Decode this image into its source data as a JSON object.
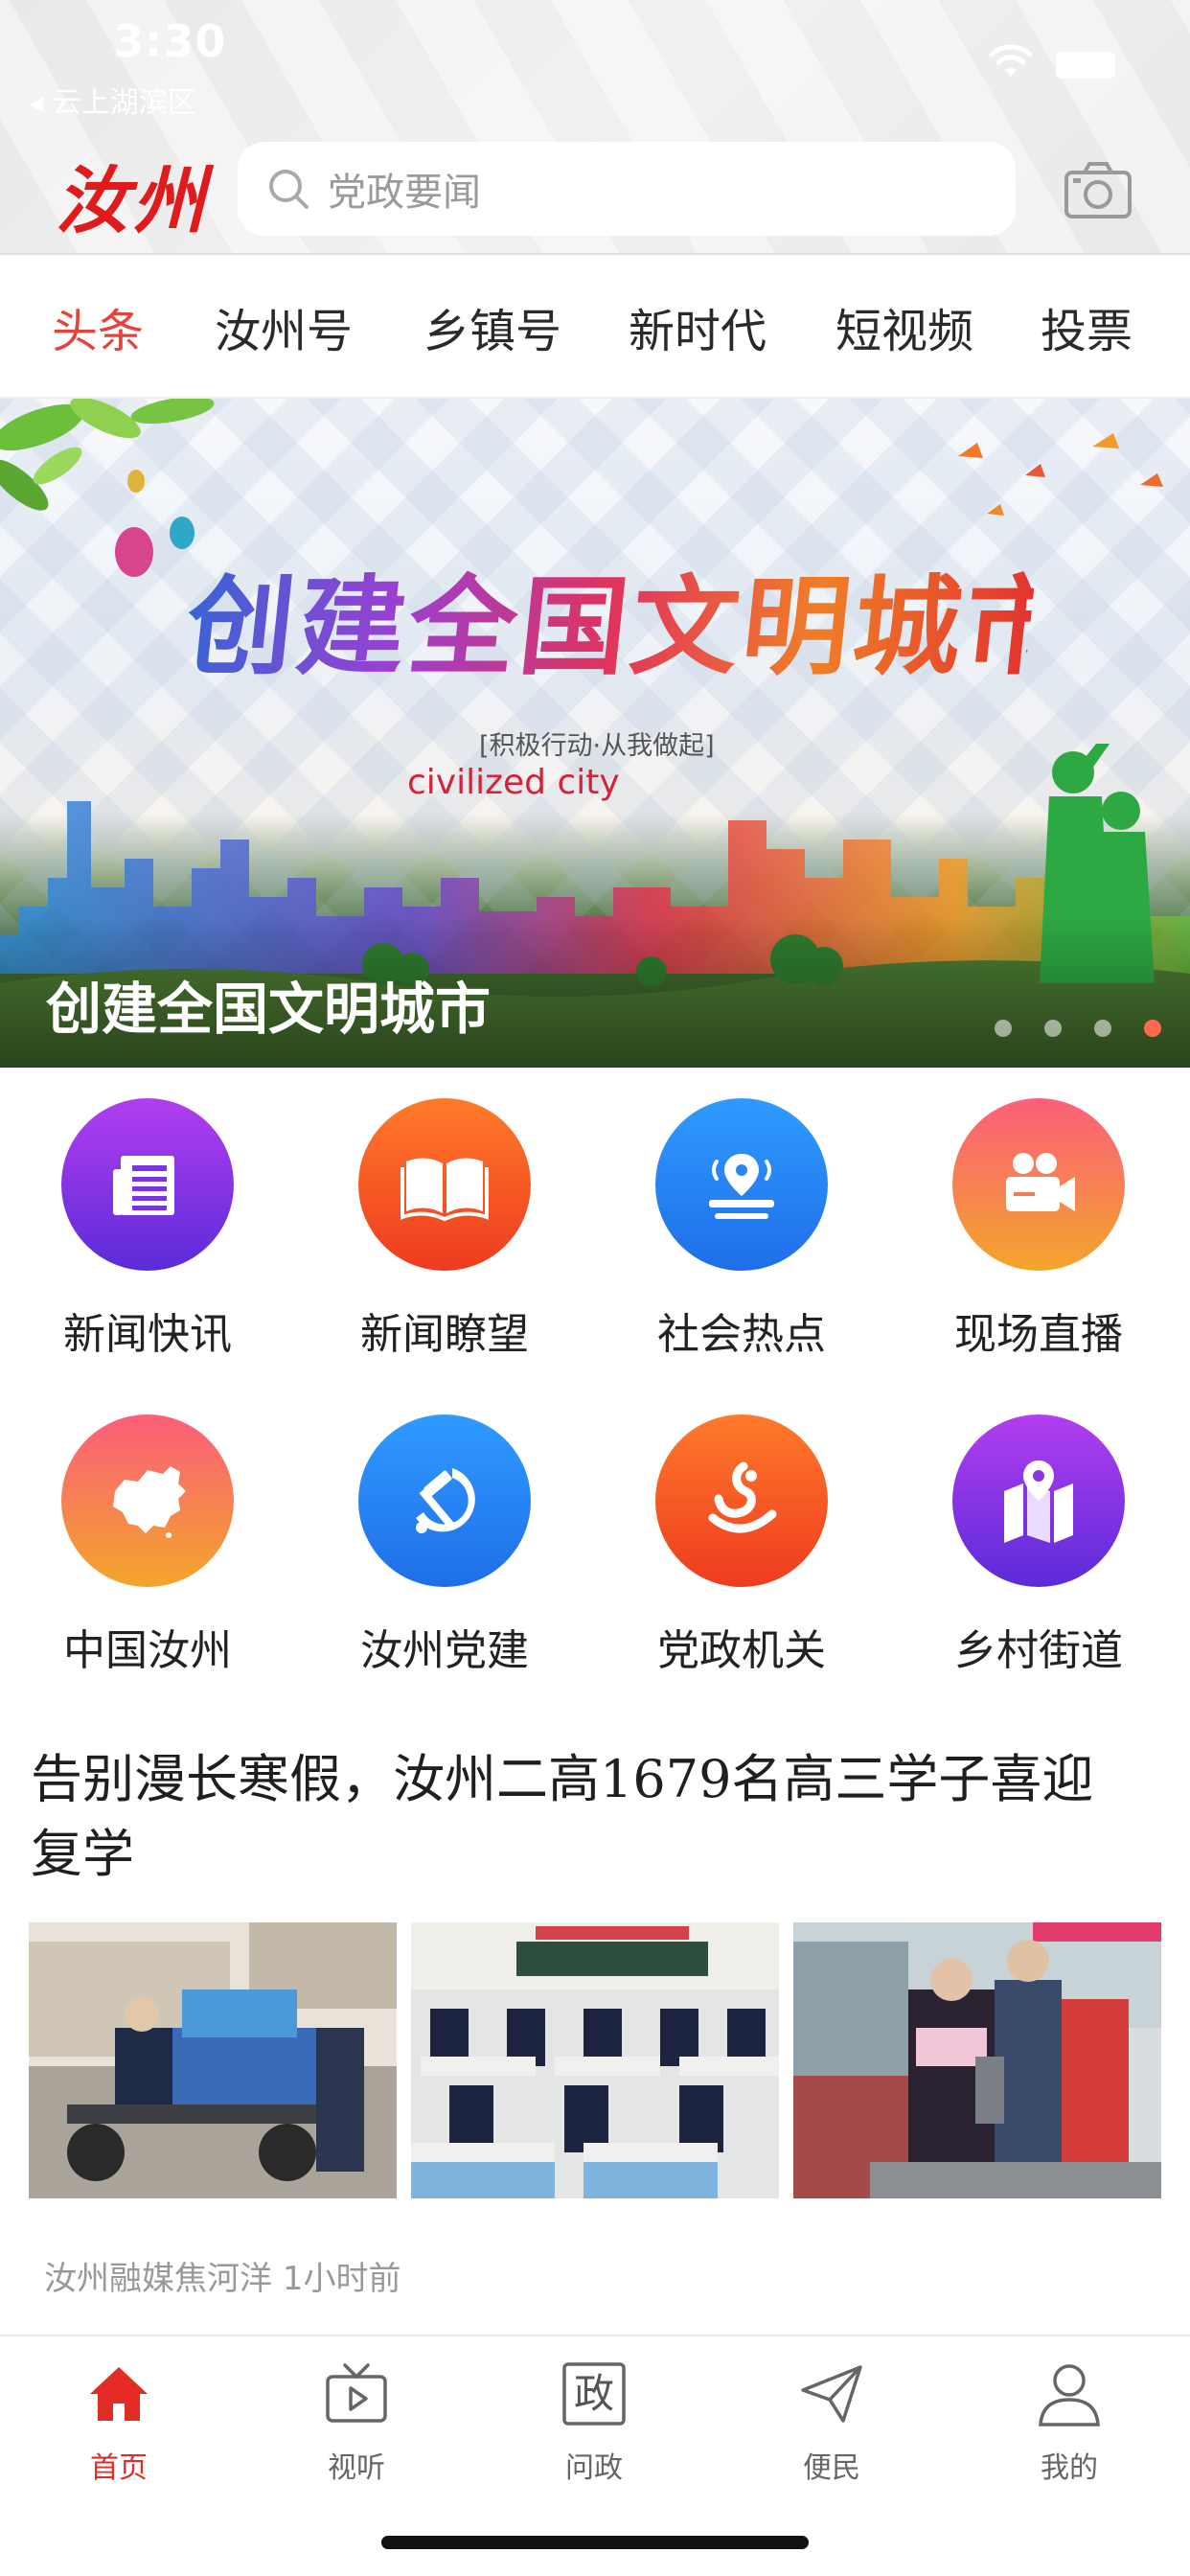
{
  "status_bar": {
    "time": "3:30",
    "back_label": "◂ 云上湖滨区"
  },
  "header": {
    "logo": "汝州",
    "search_placeholder": "党政要闻"
  },
  "tabs": [
    {
      "label": "头条",
      "active": true
    },
    {
      "label": "汝州号"
    },
    {
      "label": "乡镇号"
    },
    {
      "label": "新时代"
    },
    {
      "label": "短视频"
    },
    {
      "label": "投票"
    }
  ],
  "banner": {
    "slogan": "创建全国文明城市",
    "sub1": "[积极行动·从我做起]",
    "sub2": "civilized city",
    "caption": "创建全国文明城市",
    "dot_count": 4,
    "active_dot": 4
  },
  "grid": [
    {
      "label": "新闻快讯",
      "icon": "newspaper-icon",
      "color_from": "#b23ef0",
      "color_to": "#5b2bd8"
    },
    {
      "label": "新闻瞭望",
      "icon": "open-book-icon",
      "color_from": "#ff7a2a",
      "color_to": "#ee3b1f"
    },
    {
      "label": "社会热点",
      "icon": "location-pin-icon",
      "color_from": "#2f9bff",
      "color_to": "#1f6ee8"
    },
    {
      "label": "现场直播",
      "icon": "video-camera-icon",
      "color_from": "#fb5e7a",
      "color_to": "#f3a52c"
    },
    {
      "label": "中国汝州",
      "icon": "china-map-icon",
      "color_from": "#fb5e7a",
      "color_to": "#f3a52c"
    },
    {
      "label": "汝州党建",
      "icon": "hammer-sickle-icon",
      "color_from": "#2f9bff",
      "color_to": "#1f6ee8"
    },
    {
      "label": "党政机关",
      "icon": "emblem-icon",
      "color_from": "#ff7a2a",
      "color_to": "#ee3b1f"
    },
    {
      "label": "乡村街道",
      "icon": "map-pin-icon",
      "color_from": "#b23ef0",
      "color_to": "#5b2bd8"
    }
  ],
  "article": {
    "title": "告别漫长寒假，汝州二高1679名高三学子喜迎复学",
    "source": "汝州融媒焦河洋",
    "time": "1小时前"
  },
  "bottom_nav": [
    {
      "label": "首页",
      "icon": "home-icon",
      "active": true
    },
    {
      "label": "视听",
      "icon": "tv-play-icon"
    },
    {
      "label": "问政",
      "icon": "zheng-icon",
      "icon_text": "政"
    },
    {
      "label": "便民",
      "icon": "paper-plane-icon"
    },
    {
      "label": "我的",
      "icon": "user-icon"
    }
  ],
  "colors": {
    "accent": "#e8413a",
    "nav_active": "#e22c25"
  }
}
